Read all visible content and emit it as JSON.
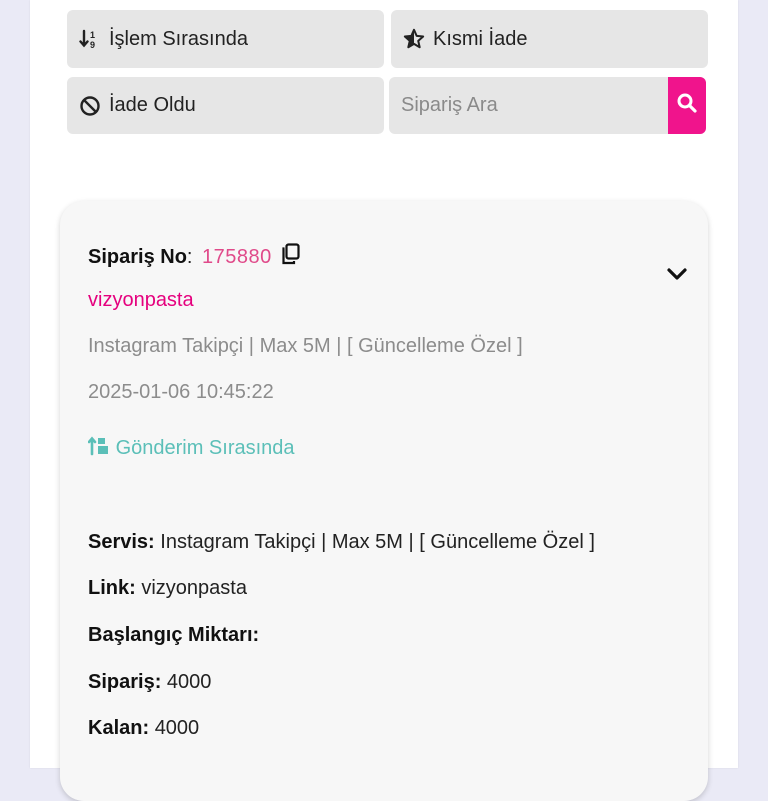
{
  "filters": {
    "processing_label": "İşlem Sırasında",
    "partial_refund_label": "Kısmi İade",
    "refunded_label": "İade Oldu"
  },
  "search": {
    "placeholder": "Sipariş Ara"
  },
  "order": {
    "number_label": "Sipariş No",
    "number_sep": ":",
    "number_value": "175880",
    "username": "vizyonpasta",
    "service_name": "Instagram Takipçi | Max 5M | [ Güncelleme Özel ]",
    "date": "2025-01-06 10:45:22",
    "status": "Gönderim Sırasında",
    "details": {
      "service_label": "Servis:",
      "service_value": "Instagram Takipçi | Max 5M | [ Güncelleme Özel ]",
      "link_label": "Link:",
      "link_value": "vizyonpasta",
      "start_label": "Başlangıç Miktarı:",
      "start_value": "",
      "order_label": "Sipariş:",
      "order_value": "4000",
      "remaining_label": "Kalan:",
      "remaining_value": "4000"
    }
  },
  "colors": {
    "accent_pink": "#f0148c",
    "status_teal": "#5bbfb8"
  },
  "icons": {
    "processing": "sort-numeric-icon",
    "partial_refund": "star-half-icon",
    "refunded": "ban-icon",
    "search": "search-icon",
    "copy": "copy-icon",
    "expand": "chevron-down-icon",
    "status": "sort-amount-icon"
  }
}
